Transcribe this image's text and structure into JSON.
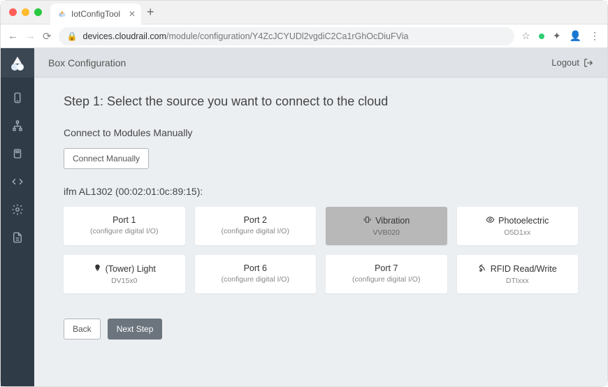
{
  "browser": {
    "tab_title": "IotConfigTool",
    "url_host": "devices.cloudrail.com",
    "url_path": "/module/configuration/Y4ZcJCYUDl2vgdiC2Ca1rGhOcDiuFVia"
  },
  "sidebar": {
    "items": [
      {
        "name": "device-icon"
      },
      {
        "name": "hierarchy-icon"
      },
      {
        "name": "module-icon"
      },
      {
        "name": "code-icon"
      },
      {
        "name": "gear-icon"
      },
      {
        "name": "document-icon"
      }
    ]
  },
  "topbar": {
    "title": "Box Configuration",
    "logout_label": "Logout"
  },
  "main": {
    "step_heading": "Step 1: Select the source you want to connect to the cloud",
    "manual_heading": "Connect to Modules Manually",
    "manual_button": "Connect Manually",
    "device_label": "ifm AL1302 (00:02:01:0c:89:15):",
    "ports": [
      {
        "title": "Port 1",
        "sub": "(configure digital I/O)",
        "icon": null,
        "selected": false
      },
      {
        "title": "Port 2",
        "sub": "(configure digital I/O)",
        "icon": null,
        "selected": false
      },
      {
        "title": "Vibration",
        "sub": "VVB020",
        "icon": "vibration-icon",
        "selected": true
      },
      {
        "title": "Photoelectric",
        "sub": "O5D1xx",
        "icon": "eye-icon",
        "selected": false
      },
      {
        "title": "(Tower) Light",
        "sub": "DV15x0",
        "icon": "bulb-icon",
        "selected": false
      },
      {
        "title": "Port 6",
        "sub": "(configure digital I/O)",
        "icon": null,
        "selected": false
      },
      {
        "title": "Port 7",
        "sub": "(configure digital I/O)",
        "icon": null,
        "selected": false
      },
      {
        "title": "RFID Read/Write",
        "sub": "DTIxxx",
        "icon": "rfid-icon",
        "selected": false
      }
    ],
    "back_label": "Back",
    "next_label": "Next Step"
  }
}
